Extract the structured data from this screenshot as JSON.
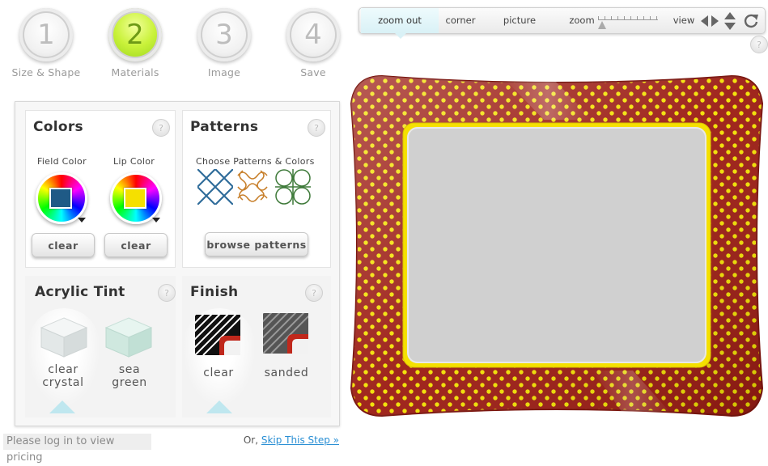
{
  "steps": [
    {
      "number": "1",
      "label": "Size & Shape"
    },
    {
      "number": "2",
      "label": "Materials"
    },
    {
      "number": "3",
      "label": "Image"
    },
    {
      "number": "4",
      "label": "Save"
    }
  ],
  "colors": {
    "title": "Colors",
    "help": "?",
    "field_label": "Field Color",
    "lip_label": "Lip Color",
    "field_color": "#1f5a86",
    "lip_color": "#f5e000",
    "clear_label": "clear"
  },
  "patterns": {
    "title": "Patterns",
    "help": "?",
    "subtitle": "Choose Patterns & Colors",
    "browse_label": "browse patterns"
  },
  "tint": {
    "title": "Acrylic Tint",
    "help": "?",
    "options": [
      {
        "line1": "clear",
        "line2": "crystal"
      },
      {
        "line1": "sea",
        "line2": "green"
      }
    ]
  },
  "finish": {
    "title": "Finish",
    "help": "?",
    "options": [
      "clear",
      "sanded"
    ]
  },
  "footer": {
    "pricing": "Please log in to view pricing",
    "or_text": "Or,",
    "skip_link": "Skip This Step »"
  },
  "toolbar": {
    "zoom_out": "zoom out",
    "corner": "corner",
    "picture": "picture",
    "zoom": "zoom",
    "view": "view"
  },
  "frame": {
    "field_color": "#9b1b12",
    "dot_color": "#f2e000",
    "lip_color": "#f5e000"
  }
}
